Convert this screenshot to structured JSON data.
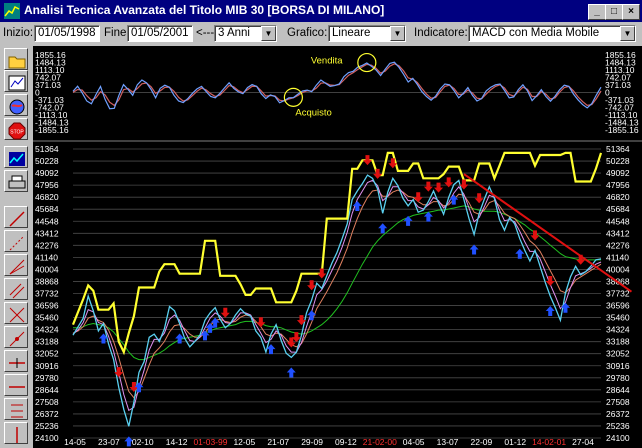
{
  "window": {
    "title": "Analisi Tecnica Avanzata del Titolo  MIB 30  [BORSA DI MILANO]",
    "minimize_label": "_",
    "maximize_label": "□",
    "close_label": "×"
  },
  "toolbar": {
    "start_label": "Inizio:",
    "start_value": "01/05/1998",
    "end_label": "Fine:",
    "end_value": "01/05/2001",
    "period_prefix": "<---",
    "period_value": "3 Anni",
    "chart_label": "Grafico:",
    "chart_value": "Lineare",
    "indicator_label": "Indicatore:",
    "indicator_value": "MACD con Media Mobile"
  },
  "palette": [
    {
      "name": "open-folder-icon"
    },
    {
      "name": "chart-edit-icon"
    },
    {
      "name": "globe-icon"
    },
    {
      "name": "stop-icon"
    },
    {
      "name": "line-chart-icon"
    },
    {
      "name": "printer-icon"
    },
    {
      "name": "trendline-tool-icon"
    },
    {
      "name": "dotted-line-tool-icon"
    },
    {
      "name": "fan-line-tool-icon"
    },
    {
      "name": "parallel-lines-tool-icon"
    },
    {
      "name": "cross-tool-icon"
    },
    {
      "name": "diagonal-tool-icon"
    },
    {
      "name": "horizontal-line-tool-icon"
    },
    {
      "name": "level-tool-icon"
    },
    {
      "name": "fibonacci-tool-icon"
    },
    {
      "name": "vertical-line-tool-icon"
    },
    {
      "name": "bracket-tool-icon"
    }
  ],
  "chart_data": [
    {
      "type": "line",
      "panel": "oscillator",
      "title": "",
      "y_ticks": [
        "1855.16",
        "1484.13",
        "1113.10",
        "742.07",
        "371.03",
        "0",
        "-371.03",
        "-742.07",
        "-1113.10",
        "-1484.13",
        "-1855.16"
      ],
      "ylim": [
        -1855.16,
        1855.16
      ],
      "annotations": [
        {
          "text": "Vendita",
          "x_index": 64,
          "value": 1480
        },
        {
          "text": "Acquisto",
          "x_index": 48,
          "value": -240
        }
      ],
      "series": [
        {
          "color": "#6fa0ff",
          "values": [
            60,
            310,
            -20,
            -420,
            -560,
            -100,
            300,
            -340,
            -800,
            -780,
            -140,
            390,
            150,
            -140,
            380,
            620,
            480,
            150,
            -260,
            210,
            360,
            260,
            -140,
            -420,
            -500,
            -300,
            -40,
            180,
            300,
            50,
            -200,
            -260,
            -40,
            230,
            480,
            210,
            30,
            -60,
            240,
            390,
            300,
            -60,
            -300,
            -120,
            -200,
            -510,
            -400,
            -260,
            -250,
            -80,
            80,
            120,
            40,
            360,
            620,
            460,
            300,
            340,
            420,
            780,
            980,
            1050,
            1250,
            1340,
            1460,
            1300,
            1120,
            840,
            1150,
            1440,
            1500,
            1240,
            900,
            520,
            700,
            400,
            40,
            -200,
            -380,
            -180,
            180,
            420,
            380,
            90,
            -260,
            -40,
            240,
            -140,
            -420,
            -300,
            80,
            260,
            380,
            420,
            100,
            -260,
            -220,
            150,
            380,
            80,
            -400,
            -160,
            140,
            -200,
            -430,
            -180,
            140,
            360,
            300,
            -80,
            -360,
            -600,
            -760,
            -550,
            -120,
            260
          ]
        },
        {
          "color": "#d06060",
          "values": [
            0,
            150,
            120,
            -160,
            -380,
            -260,
            40,
            -120,
            -480,
            -640,
            -360,
            140,
            200,
            20,
            200,
            430,
            470,
            280,
            -40,
            80,
            250,
            260,
            60,
            -240,
            -420,
            -360,
            -160,
            60,
            220,
            130,
            -60,
            -200,
            -130,
            100,
            340,
            280,
            100,
            -10,
            140,
            300,
            300,
            80,
            -180,
            -150,
            -170,
            -380,
            -420,
            -320,
            -260,
            -150,
            0,
            90,
            70,
            220,
            460,
            480,
            370,
            350,
            390,
            620,
            850,
            980,
            1140,
            1270,
            1390,
            1350,
            1200,
            960,
            1060,
            1300,
            1420,
            1320,
            1070,
            720,
            660,
            500,
            200,
            -80,
            -280,
            -240,
            40,
            300,
            360,
            200,
            -100,
            -80,
            120,
            -20,
            -280,
            -310,
            -80,
            140,
            300,
            380,
            220,
            -100,
            -180,
            40,
            260,
            160,
            -200,
            -200,
            40,
            -80,
            -320,
            -260,
            20,
            240,
            300,
            80,
            -220,
            -450,
            -640,
            -600,
            -300,
            80
          ]
        }
      ]
    },
    {
      "type": "line",
      "panel": "price",
      "title": "",
      "y_ticks": [
        "51364",
        "50228",
        "49092",
        "47956",
        "46820",
        "45684",
        "44548",
        "43412",
        "42276",
        "41140",
        "40004",
        "38868",
        "37732",
        "36596",
        "35460",
        "34324",
        "33188",
        "32052",
        "30916",
        "29780",
        "28644",
        "27508",
        "26372",
        "25236",
        "24100"
      ],
      "ylim": [
        24100,
        51364
      ],
      "x_ticks": [
        {
          "label": "14-05",
          "color": "#ffffff"
        },
        {
          "label": "23-07",
          "color": "#ffffff"
        },
        {
          "label": "02-10",
          "color": "#ffffff"
        },
        {
          "label": "14-12",
          "color": "#ffffff"
        },
        {
          "label": "01-03-99",
          "color": "#ff3030"
        },
        {
          "label": "12-05",
          "color": "#ffffff"
        },
        {
          "label": "21-07",
          "color": "#ffffff"
        },
        {
          "label": "29-09",
          "color": "#ffffff"
        },
        {
          "label": "09-12",
          "color": "#ffffff"
        },
        {
          "label": "21-02-00",
          "color": "#ff3030"
        },
        {
          "label": "04-05",
          "color": "#ffffff"
        },
        {
          "label": "13-07",
          "color": "#ffffff"
        },
        {
          "label": "22-09",
          "color": "#ffffff"
        },
        {
          "label": "01-12",
          "color": "#ffffff"
        },
        {
          "label": "14-02-01",
          "color": "#ff3030"
        },
        {
          "label": "27-04",
          "color": "#ffffff"
        }
      ],
      "series": [
        {
          "color": "#5ad0f0",
          "values": [
            33800,
            34600,
            35400,
            37500,
            36100,
            34200,
            34900,
            33000,
            31500,
            28900,
            26800,
            25200,
            27500,
            30300,
            31300,
            33600,
            33900,
            33200,
            34400,
            36500,
            36100,
            34900,
            33500,
            32700,
            33200,
            33800,
            35200,
            35900,
            36400,
            35300,
            34500,
            34900,
            35700,
            36300,
            35800,
            35600,
            34200,
            33600,
            32200,
            33900,
            34800,
            33300,
            32100,
            31700,
            32200,
            33800,
            35900,
            37100,
            38700,
            38200,
            39400,
            40600,
            41600,
            42900,
            44300,
            46600,
            47400,
            48100,
            48900,
            48600,
            47600,
            45300,
            47300,
            48600,
            47900,
            46700,
            46000,
            46600,
            45400,
            45600,
            46400,
            47400,
            46300,
            45200,
            46800,
            48000,
            48400,
            46600,
            44800,
            43300,
            45300,
            46600,
            47800,
            46700,
            44700,
            43700,
            44900,
            44300,
            42900,
            41800,
            40800,
            41800,
            40300,
            38800,
            37500,
            36400,
            35200,
            37800,
            39300,
            40300,
            39500,
            39800,
            40300,
            40900,
            41000
          ]
        },
        {
          "color": "#e090f0",
          "values": [
            33900,
            34300,
            35000,
            36200,
            36000,
            35000,
            34800,
            33700,
            32300,
            30300,
            28200,
            26700,
            27000,
            28900,
            30500,
            32400,
            33400,
            33400,
            34000,
            35300,
            35700,
            35200,
            34200,
            33300,
            33200,
            33600,
            34500,
            35400,
            35900,
            35600,
            35000,
            34900,
            35300,
            35900,
            35900,
            35700,
            34800,
            34000,
            33100,
            33400,
            34200,
            33800,
            32800,
            32200,
            32200,
            33100,
            34600,
            36000,
            37600,
            38100,
            38900,
            39900,
            40900,
            42100,
            43500,
            45300,
            46600,
            47400,
            48200,
            48400,
            47900,
            46500,
            46900,
            47800,
            47800,
            47200,
            46500,
            46500,
            45900,
            45700,
            46100,
            46800,
            46500,
            45800,
            46300,
            47200,
            47800,
            47100,
            45800,
            44500,
            44900,
            45900,
            47000,
            46800,
            45600,
            44600,
            44700,
            44500,
            43600,
            42600,
            41700,
            41700,
            41000,
            39800,
            38600,
            37500,
            36300,
            36900,
            38300,
            39400,
            39600,
            39800,
            40100,
            40500,
            40700
          ]
        },
        {
          "color": "#e08060",
          "values": [
            34000,
            34200,
            34600,
            35400,
            35600,
            35200,
            35000,
            34300,
            33200,
            31700,
            30000,
            28500,
            27900,
            28500,
            29700,
            31000,
            32100,
            32600,
            33200,
            34100,
            34700,
            34800,
            34400,
            33900,
            33600,
            33600,
            34000,
            34700,
            35200,
            35300,
            35100,
            35000,
            35100,
            35500,
            35700,
            35600,
            35100,
            34600,
            33900,
            33700,
            34000,
            33900,
            33400,
            32900,
            32700,
            33000,
            33900,
            35000,
            36300,
            37100,
            37900,
            38800,
            39700,
            40800,
            42000,
            43500,
            44800,
            45900,
            46800,
            47400,
            47500,
            46900,
            46900,
            47300,
            47500,
            47300,
            46900,
            46800,
            46400,
            46100,
            46100,
            46400,
            46400,
            46000,
            46100,
            46600,
            47100,
            47000,
            46300,
            45400,
            45200,
            45600,
            46300,
            46500,
            46000,
            45300,
            45000,
            44800,
            44200,
            43500,
            42700,
            42300,
            41700,
            40800,
            39900,
            39000,
            38000,
            37800,
            38300,
            39000,
            39300,
            39600,
            39900,
            40200,
            40500
          ]
        },
        {
          "color": "#20c020",
          "values": [
            34500,
            34500,
            34600,
            34800,
            34900,
            34800,
            34700,
            34500,
            34100,
            33500,
            32900,
            32200,
            31700,
            31500,
            31500,
            31700,
            31900,
            32100,
            32400,
            32800,
            33100,
            33400,
            33500,
            33600,
            33700,
            33800,
            34000,
            34200,
            34400,
            34500,
            34600,
            34700,
            34800,
            35000,
            35100,
            35100,
            35000,
            34900,
            34700,
            34600,
            34600,
            34500,
            34300,
            34100,
            34000,
            33900,
            34000,
            34200,
            34500,
            34800,
            35200,
            35700,
            36300,
            37000,
            37800,
            38700,
            39600,
            40500,
            41300,
            42100,
            42700,
            43200,
            43600,
            44000,
            44400,
            44700,
            44900,
            45100,
            45200,
            45300,
            45400,
            45500,
            45600,
            45600,
            45700,
            45800,
            45900,
            46000,
            45900,
            45700,
            45600,
            45500,
            45500,
            45500,
            45400,
            45200,
            45000,
            44800,
            44500,
            44200,
            43800,
            43500,
            43100,
            42700,
            42300,
            41900,
            41500,
            41200,
            41100,
            41000,
            40900,
            40900,
            40900,
            40900,
            40900
          ]
        },
        {
          "color": "#ffff30",
          "values": [
            34800,
            36000,
            37200,
            38500,
            38000,
            36200,
            36200,
            36200,
            36800,
            33200,
            32200,
            34000,
            35600,
            38300,
            38300,
            38300,
            38300,
            39800,
            40500,
            40500,
            40500,
            39600,
            39600,
            39600,
            39600,
            39600,
            42700,
            42700,
            42700,
            39400,
            39400,
            39400,
            39400,
            38600,
            37600,
            37600,
            38200,
            38200,
            38200,
            38200,
            36900,
            36900,
            36900,
            36900,
            38000,
            39600,
            39600,
            39600,
            39600,
            39600,
            44800,
            44800,
            44800,
            44800,
            44800,
            49500,
            49500,
            50300,
            50300,
            50300,
            48900,
            48900,
            51000,
            51000,
            49300,
            49300,
            49300,
            50000,
            50000,
            48600,
            48600,
            48600,
            48600,
            49000,
            49700,
            49700,
            49700,
            48400,
            48400,
            48400,
            50000,
            50000,
            50000,
            48600,
            49800,
            51000,
            51000,
            51000,
            51000,
            51000,
            51000,
            49800,
            50800,
            50800,
            50800,
            50800,
            50800,
            51000,
            51000,
            48300,
            48300,
            48300,
            48300,
            49500,
            51000
          ]
        },
        {
          "color": "#e01010",
          "name": "",
          "trendline": [
            [
              77,
              49000
            ],
            [
              110,
              37900
            ]
          ]
        }
      ],
      "sell_signals": [
        9,
        12,
        30,
        37,
        43,
        44,
        45,
        47,
        49,
        58,
        60,
        63,
        68,
        70,
        72,
        74,
        77,
        80,
        91,
        94,
        100
      ],
      "buy_signals": [
        6,
        11,
        13,
        21,
        26,
        27,
        28,
        39,
        43,
        47,
        56,
        61,
        66,
        70,
        75,
        79,
        88,
        94,
        97
      ]
    }
  ]
}
